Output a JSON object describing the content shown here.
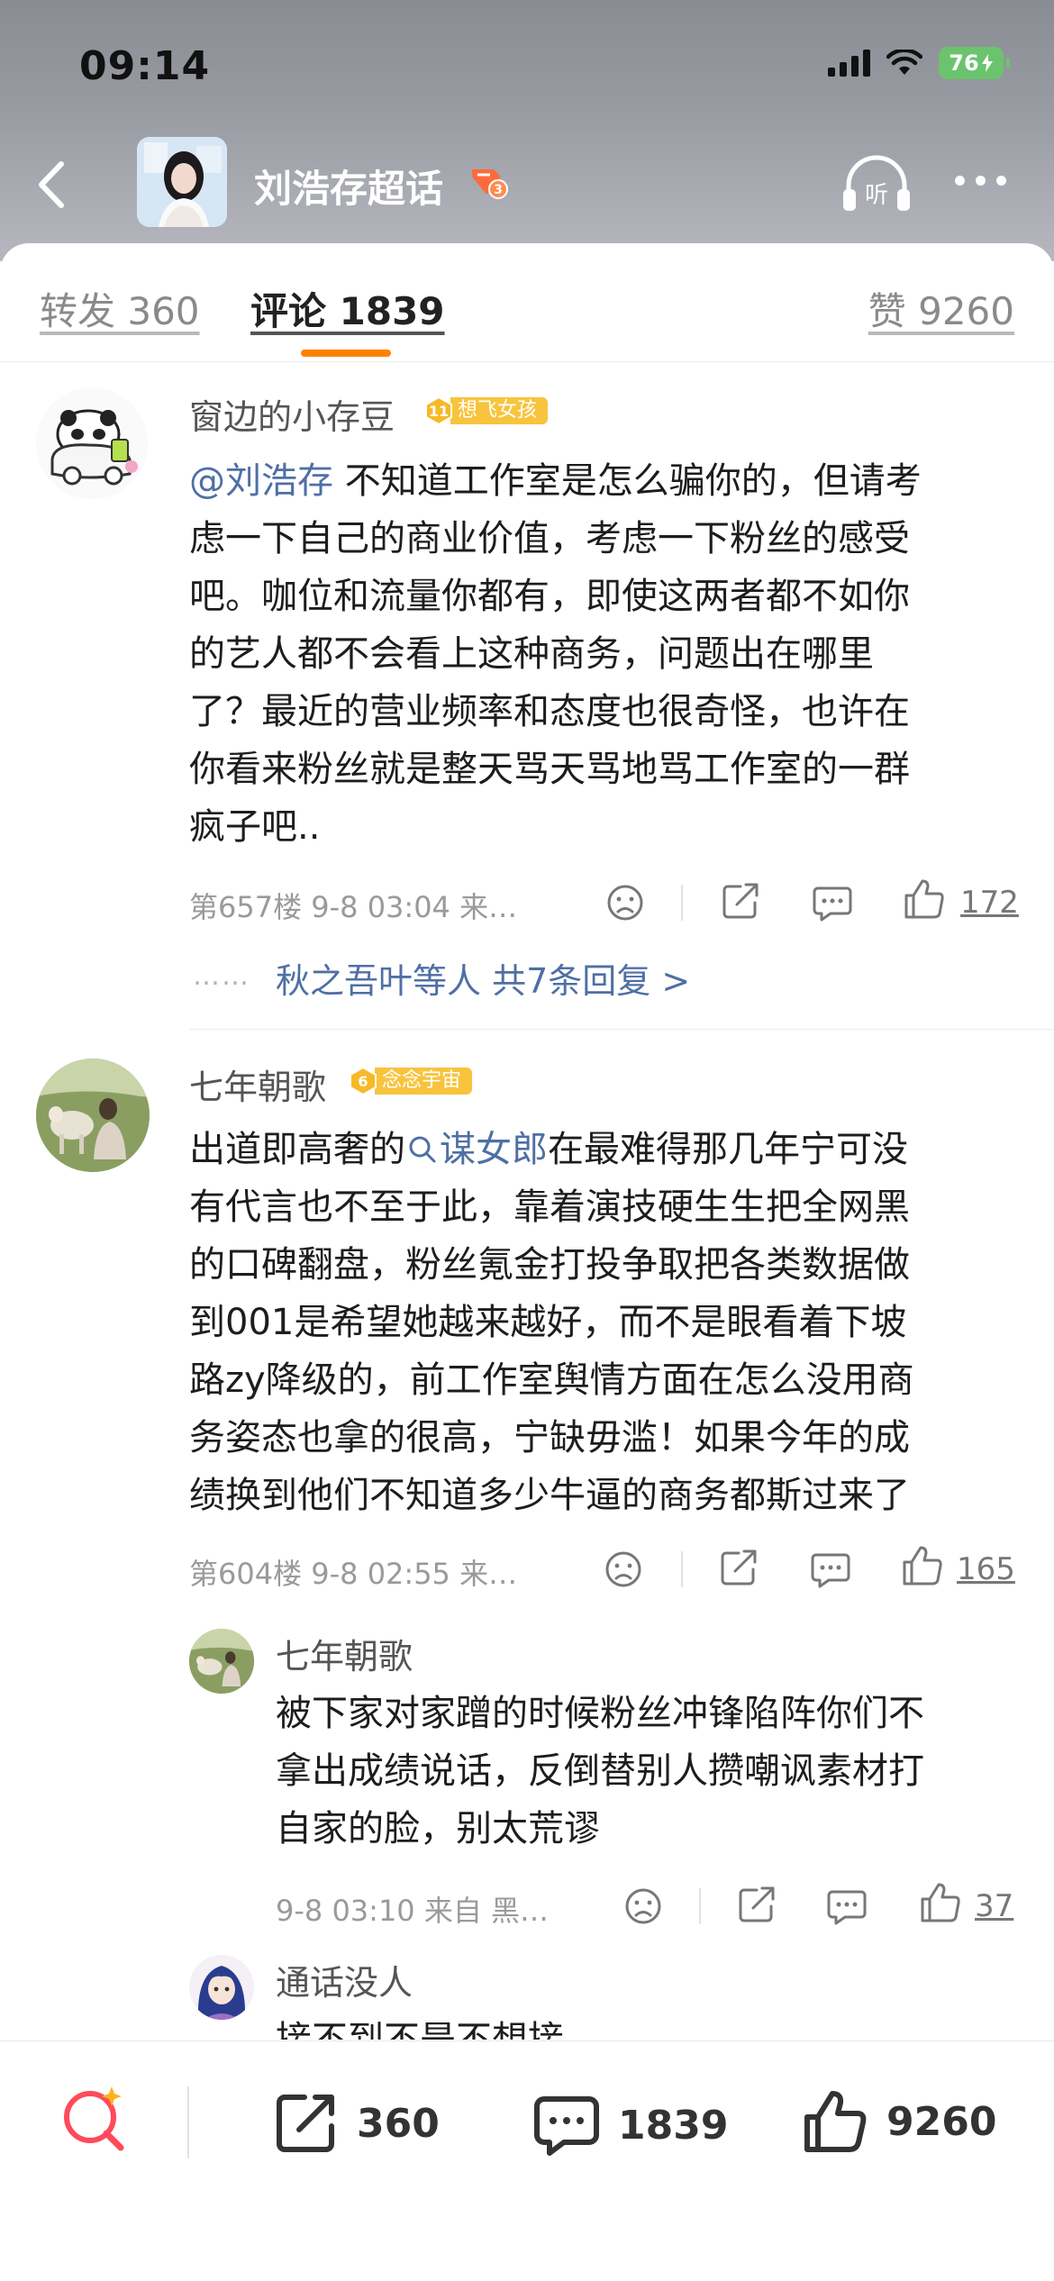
{
  "status_bar": {
    "time": "09:14",
    "battery": "76"
  },
  "header": {
    "title": "刘浩存超话",
    "badge_level": "3"
  },
  "tabs": [
    {
      "label": "转发 360"
    },
    {
      "label": "评论 1839"
    },
    {
      "label": "赞 9260"
    }
  ],
  "comments": [
    {
      "username": "窗边的小存豆",
      "fan_level": "11",
      "fan_badge": "想飞女孩",
      "mention": "@刘浩存",
      "lines": [
        " 不知道工作室是怎么骗你的，但请考",
        "虑一下自己的商业价值，考虑一下粉丝的感受",
        "吧。咖位和流量你都有，即使这两者都不如你",
        "的艺人都不会看上这种商务，问题出在哪里",
        "了？最近的营业频率和态度也很奇怪，也许在",
        "你看来粉丝就是整天骂天骂地骂工作室的一群",
        "疯子吧.."
      ],
      "meta": "第657楼 9-8 03:04 来…",
      "likes": "172",
      "replies_dots": "……",
      "replies_link": "秋之吾叶等人 共7条回复 >"
    },
    {
      "username": "七年朝歌",
      "fan_level": "6",
      "fan_badge": "念念宇宙",
      "first_line_prefix": "出道即高奢的",
      "topic_link": "谋女郎",
      "first_line_suffix": "在最难得那几年宁可没",
      "lines": [
        "有代言也不至于此，靠着演技硬生生把全网黑",
        "的口碑翻盘，粉丝氪金打投争取把各类数据做",
        "到001是希望她越来越好，而不是眼看着下坡",
        "路zy降级的，前工作室舆情方面在怎么没用商",
        "务姿态也拿的很高，宁缺毋滥！如果今年的成",
        "绩换到他们不知道多少牛逼的商务都斯过来了"
      ],
      "meta": "第604楼 9-8 02:55 来…",
      "likes": "165"
    }
  ],
  "reply": {
    "username": "七年朝歌",
    "lines": [
      "被下家对家蹭的时候粉丝冲锋陷阵你们不",
      "拿出成绩说话，反倒替别人攒嘲讽素材打",
      "自家的脸，别太荒谬"
    ],
    "meta": "9-8 03:10 来自 黑…",
    "likes": "37"
  },
  "reply2": {
    "username": "通话没人",
    "partial_text": "接不到不是不想接"
  },
  "bottom_bar": {
    "repost_count": "360",
    "comment_count": "1839",
    "like_count": "9260"
  }
}
